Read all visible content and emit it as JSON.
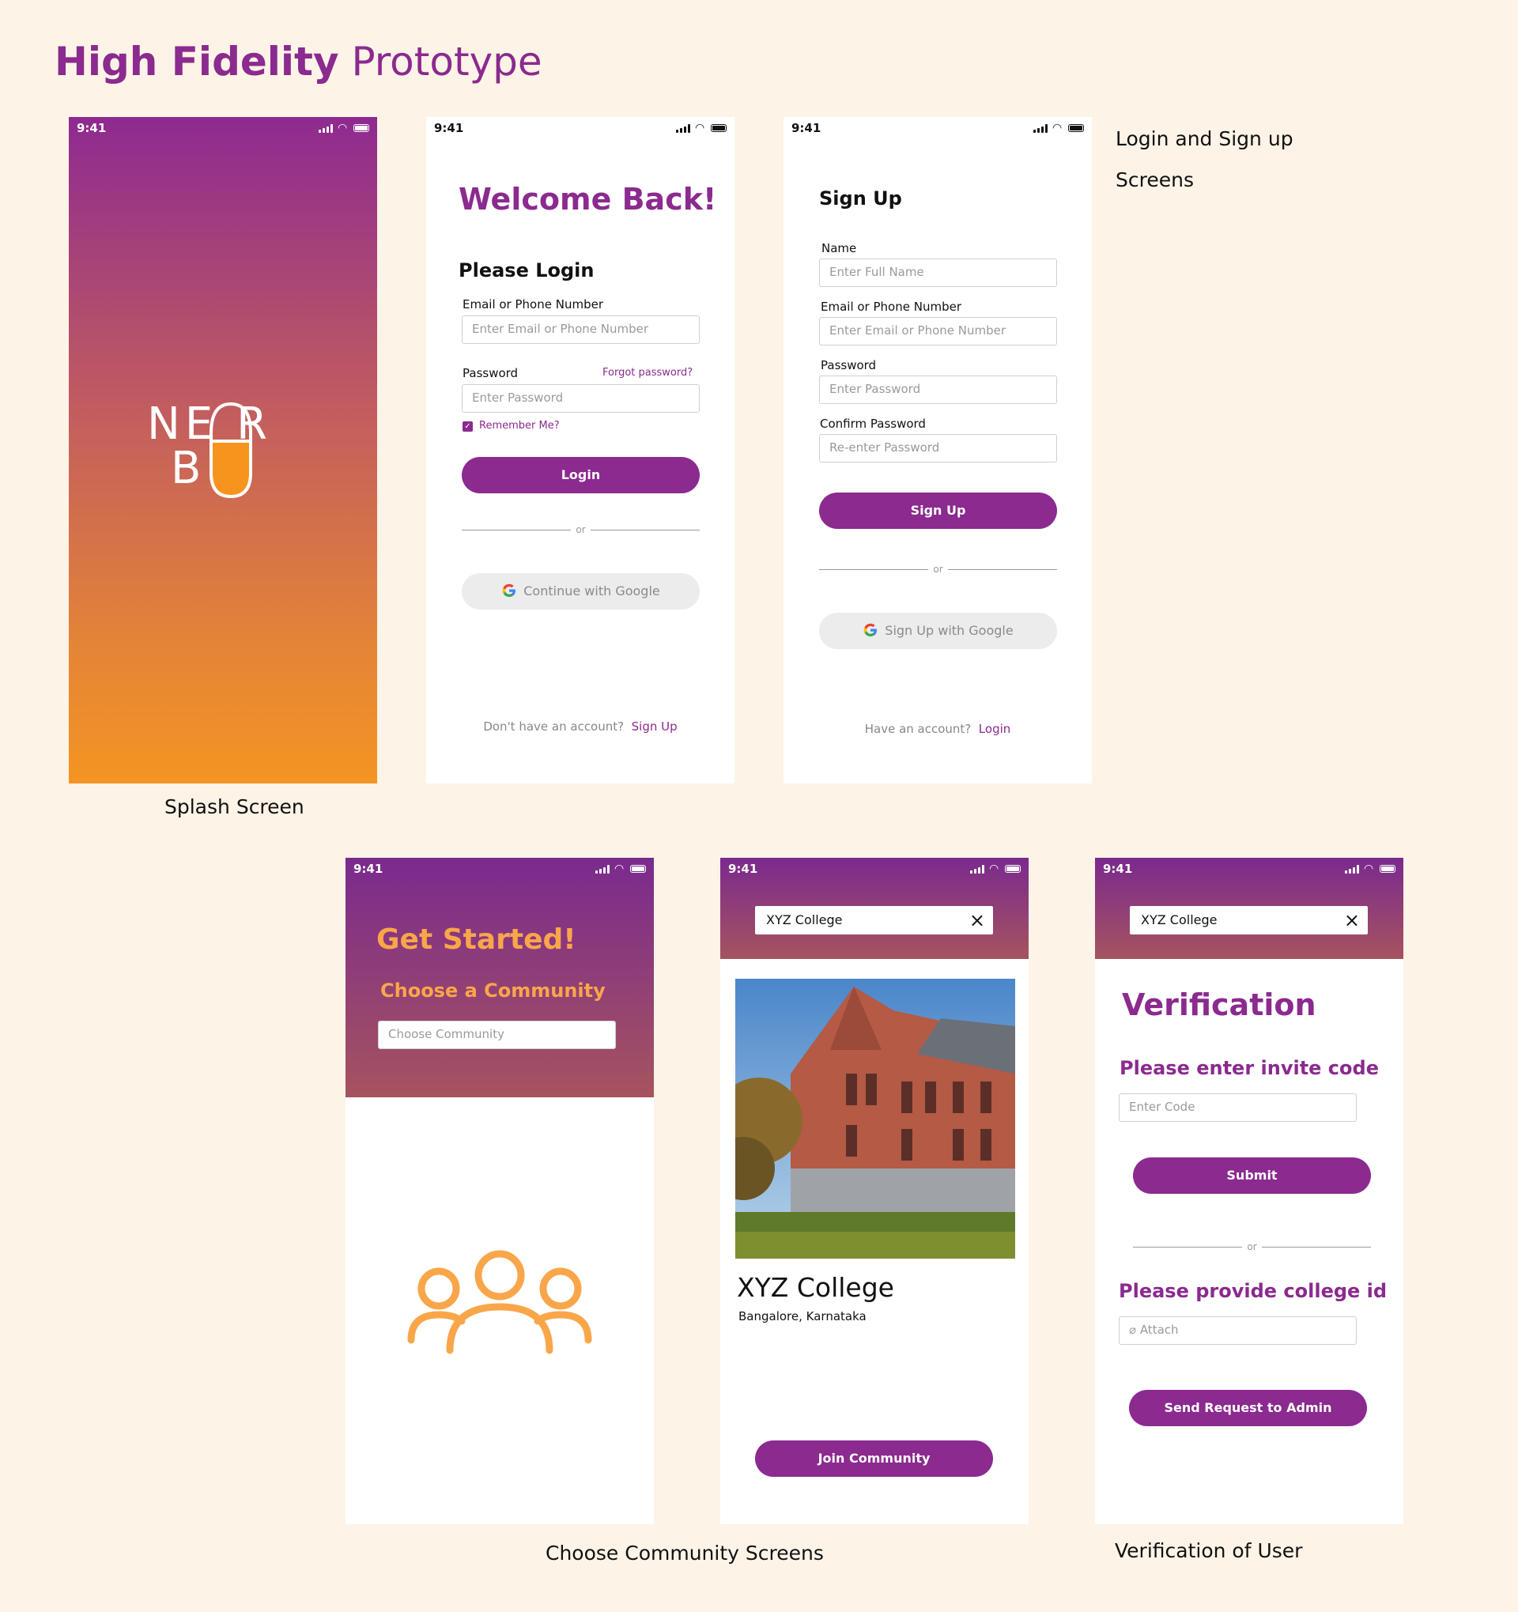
{
  "page": {
    "title_bold": "High Fidelity",
    "title_light": "Prototype"
  },
  "status": {
    "time": "9:41"
  },
  "captions": {
    "splash": "Splash Screen",
    "login_signup_line1": "Login and Sign up",
    "login_signup_line2": "Screens",
    "community": "Choose Community Screens",
    "verification": "Verification of User"
  },
  "splash": {
    "logo_line1": "NE R",
    "logo_line2": "B Y",
    "logo_bag_letter": "A",
    "colors": {
      "top": "#8e2a90",
      "bottom": "#f59422"
    }
  },
  "login": {
    "heading": "Welcome Back!",
    "subheading": "Please Login",
    "email_label": "Email or Phone Number",
    "email_placeholder": "Enter Email or Phone Number",
    "password_label": "Password",
    "forgot": "Forgot password?",
    "password_placeholder": "Enter Password",
    "remember": "Remember Me?",
    "remember_checked": true,
    "login_button": "Login",
    "or": "or",
    "google_button": "Continue with Google",
    "footer_text": "Don't have an account?",
    "footer_link": "Sign Up"
  },
  "signup": {
    "heading": "Sign Up",
    "name_label": "Name",
    "name_placeholder": "Enter Full Name",
    "email_label": "Email or Phone Number",
    "email_placeholder": "Enter Email or Phone Number",
    "password_label": "Password",
    "password_placeholder": "Enter Password",
    "confirm_label": "Confirm Password",
    "confirm_placeholder": "Re-enter Password",
    "signup_button": "Sign Up",
    "or": "or",
    "google_button": "Sign Up with Google",
    "footer_text": "Have an account?",
    "footer_link": "Login"
  },
  "get_started": {
    "heading": "Get Started!",
    "subheading": "Choose a Community",
    "placeholder": "Choose Community"
  },
  "community_detail": {
    "search_value": "XYZ College",
    "name": "XYZ College",
    "location": "Bangalore, Karnataka",
    "join_button": "Join Community"
  },
  "verification": {
    "search_value": "XYZ College",
    "heading": "Verification",
    "invite_label": "Please enter invite code",
    "invite_placeholder": "Enter Code",
    "submit_button": "Submit",
    "or": "or",
    "college_id_label": "Please provide college id",
    "attach_placeholder": "Attach",
    "send_button": "Send Request to Admin"
  },
  "colors": {
    "brand_purple": "#8b2a8f",
    "accent_orange": "#f9a64a",
    "background": "#fdf3e7"
  }
}
